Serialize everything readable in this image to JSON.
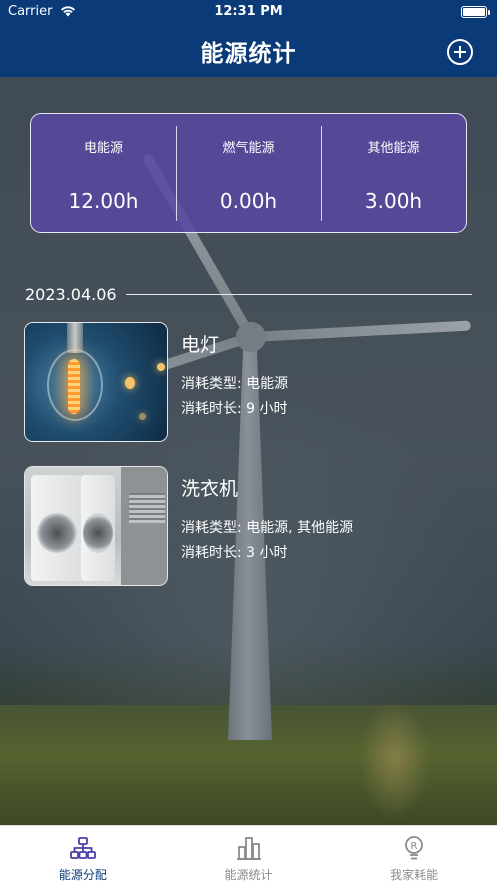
{
  "status_bar": {
    "carrier": "Carrier",
    "time": "12:31 PM"
  },
  "nav": {
    "title": "能源统计",
    "add_icon": "plus-circle-icon"
  },
  "summary": [
    {
      "label": "电能源",
      "value": "12.00h"
    },
    {
      "label": "燃气能源",
      "value": "0.00h"
    },
    {
      "label": "其他能源",
      "value": "3.00h"
    }
  ],
  "date": "2023.04.06",
  "records": [
    {
      "name": "电灯",
      "type": "消耗类型: 电能源",
      "duration": "消耗时长: 9 小时",
      "image": "light-bulb-photo"
    },
    {
      "name": "洗衣机",
      "type": "消耗类型: 电能源, 其他能源",
      "duration": "消耗时长: 3 小时",
      "image": "washing-machine-photo"
    }
  ],
  "tabs": [
    {
      "label": "能源分配",
      "icon": "hierarchy-icon",
      "active": true
    },
    {
      "label": "能源统计",
      "icon": "bar-chart-icon",
      "active": false
    },
    {
      "label": "我家耗能",
      "icon": "bulb-r-icon",
      "active": false
    }
  ],
  "colors": {
    "nav_bg": "#0a3a78",
    "card_bg": "#5848a0",
    "tab_active": "#0a3a78",
    "tab_inactive": "#8a8a8a"
  }
}
